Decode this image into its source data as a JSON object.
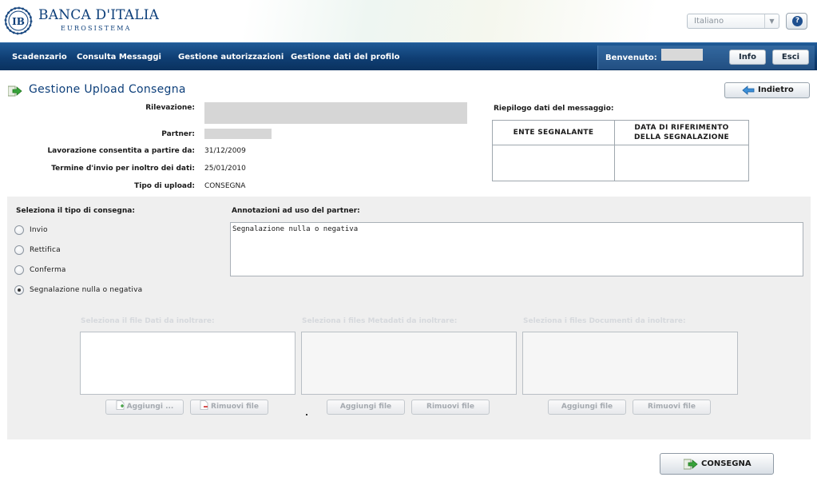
{
  "brand": {
    "name": "BANCA D'ITALIA",
    "sub": "EUROSISTEMA"
  },
  "header": {
    "language": "Italiano",
    "help": "?"
  },
  "nav": {
    "items": [
      "Scadenzario",
      "Consulta Messaggi",
      "Gestione autorizzazioni",
      "Gestione dati del profilo"
    ],
    "welcome": "Benvenuto:",
    "info": "Info",
    "exit": "Esci"
  },
  "page": {
    "title": "Gestione Upload Consegna",
    "back": "Indietro"
  },
  "info": {
    "rilevazione_label": "Rilevazione:",
    "partner_label": "Partner:",
    "lavorazione_label": "Lavorazione consentita a partire da:",
    "lavorazione_value": "31/12/2009",
    "termine_label": "Termine d'invio per inoltro dei dati:",
    "termine_value": "25/01/2010",
    "tipo_label": "Tipo di upload:",
    "tipo_value": "CONSEGNA"
  },
  "summary": {
    "title": "Riepilogo dati del messaggio:",
    "col1": "ENTE SEGNALANTE",
    "col2_line1": "DATA DI RIFERIMENTO",
    "col2_line2": "DELLA SEGNALAZIONE"
  },
  "delivery": {
    "type_label": "Seleziona il tipo di consegna:",
    "options": [
      "Invio",
      "Rettifica",
      "Conferma",
      "Segnalazione nulla o negativa"
    ],
    "selected": "Segnalazione nulla o negativa",
    "notes_label": "Annotazioni ad uso del partner:",
    "notes_value": "Segnalazione nulla o negativa"
  },
  "files": {
    "dati_label": "Seleziona il file Dati da inoltrare:",
    "metadati_label": "Seleziona i files Metadati da inoltrare:",
    "documenti_label": "Seleziona i files Documenti da inoltrare:",
    "add_dots": "Aggiungi ...",
    "remove": "Rimuovi file",
    "add": "Aggiungi file"
  },
  "submit": {
    "label": "CONSEGNA"
  }
}
